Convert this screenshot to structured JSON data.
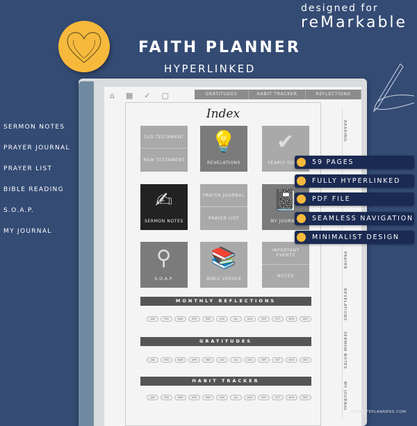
{
  "header": {
    "designed_for": "designed for",
    "brand": "reMarkable",
    "title": "FAITH PLANNER",
    "subtitle": "HYPERLINKED"
  },
  "colors": {
    "background": "#344b74",
    "accent": "#f7b93c",
    "badge": "#1b2a52"
  },
  "left_nav": [
    "SERMON NOTES",
    "PRAYER JOURNAL",
    "PRAYER LIST",
    "BIBLE READING",
    "S.O.A.P.",
    "MY JOURNAL"
  ],
  "planner": {
    "top_icons": [
      "home-icon",
      "calendar-icon",
      "check-icon",
      "notebook-icon"
    ],
    "top_tabs": [
      "GRATITUDES",
      "HABIT TRACKER",
      "REFLECTIONS"
    ],
    "index_title": "Index",
    "tiles": [
      {
        "top": "OLD TESTAMENT",
        "bottom": "NEW TESTAMENT"
      },
      {
        "label": "REVELATIONS",
        "icon": "lightbulb-icon"
      },
      {
        "label": "YEARLY GOALS",
        "icon": "check-circle-icon"
      },
      {
        "label": "SERMON NOTES",
        "icon": "writing-hand-icon"
      },
      {
        "top": "PRAYER JOURNAL",
        "bottom": "PRAYER LIST"
      },
      {
        "label": "MY JOURNAL",
        "icon": "journal-icon"
      },
      {
        "label": "S.O.A.P.",
        "icon": "magnifier-icon"
      },
      {
        "label": "BIBLE VERSES",
        "icon": "books-icon"
      },
      {
        "top": "IMPORTANT EVENTS",
        "bottom": "NOTES"
      }
    ],
    "sections": [
      "MONTHLY REFLECTIONS",
      "GRATITUDES",
      "HABIT TRACKER"
    ],
    "months": [
      "JAN",
      "FEB",
      "MAR",
      "APR",
      "MAY",
      "JUN",
      "JUL",
      "AUG",
      "SEP",
      "OCT",
      "NOV",
      "DEC"
    ],
    "side_tabs": [
      "READING",
      "",
      "",
      "",
      "PRAYER",
      "REVELATIONS",
      "SERMON NOTES",
      "MY JOURNAL"
    ]
  },
  "features": [
    "59 PAGES",
    "FULLY HYPERLINKED",
    "PDF FILE",
    "SEAMLESS NAVIGATION",
    "MINIMALIST DESIGN"
  ],
  "website": "EASYLIFEPLANNERS.COM"
}
